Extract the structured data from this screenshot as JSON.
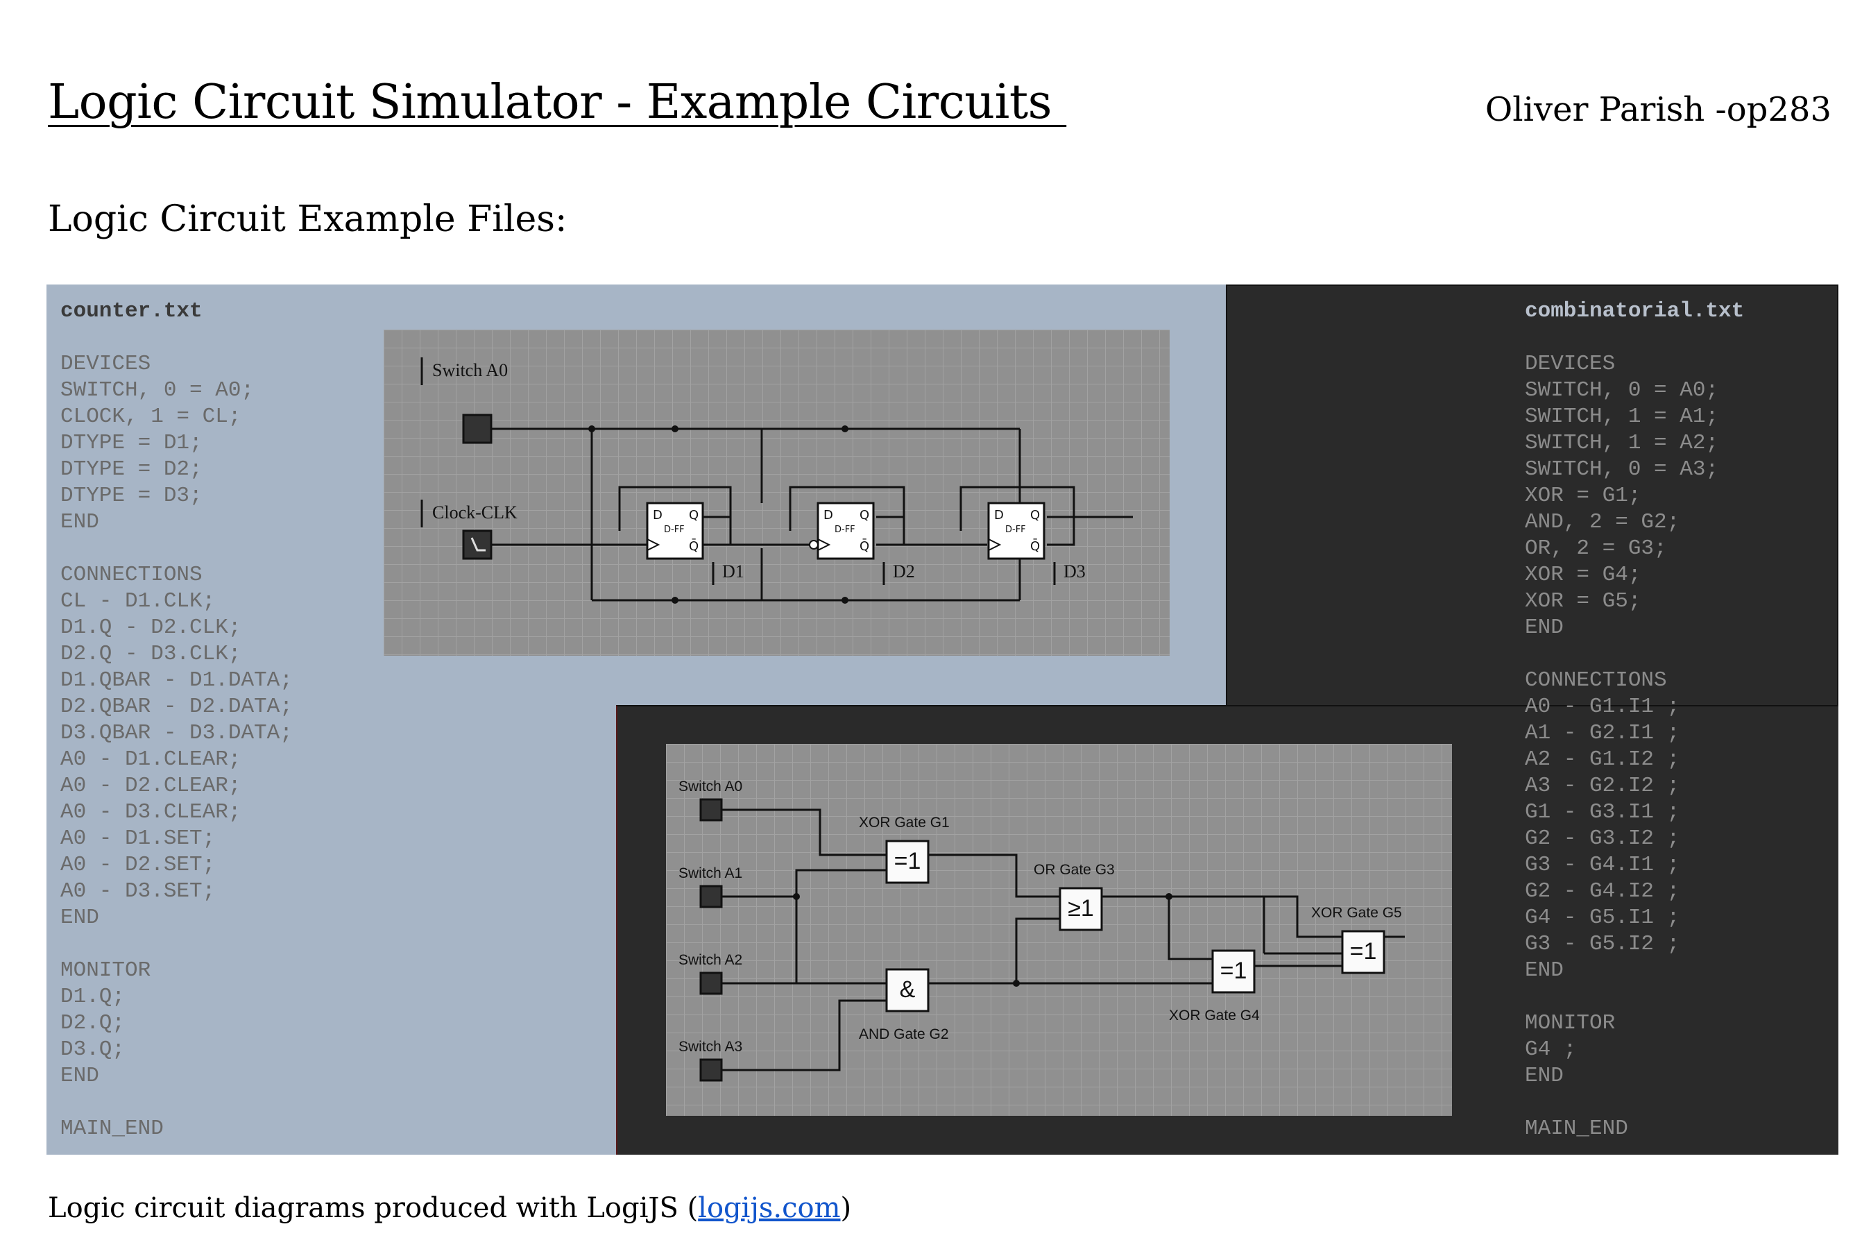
{
  "header": {
    "title": "Logic Circuit Simulator - Example Circuits ",
    "author": "Oliver Parish -op283"
  },
  "section_title": "Logic Circuit Example Files:",
  "counter_file": {
    "filename": "counter.txt",
    "lines": "DEVICES\nSWITCH, 0 = A0;\nCLOCK, 1 = CL;\nDTYPE = D1;\nDTYPE = D2;\nDTYPE = D3;\nEND\n\nCONNECTIONS\nCL - D1.CLK;\nD1.Q - D2.CLK;\nD2.Q - D3.CLK;\nD1.QBAR - D1.DATA;\nD2.QBAR - D2.DATA;\nD3.QBAR - D3.DATA;\nA0 - D1.CLEAR;\nA0 - D2.CLEAR;\nA0 - D3.CLEAR;\nA0 - D1.SET;\nA0 - D2.SET;\nA0 - D3.SET;\nEND\n\nMONITOR\nD1.Q;\nD2.Q;\nD3.Q;\nEND\n\nMAIN_END"
  },
  "combinatorial_file": {
    "filename": "combinatorial.txt",
    "lines": "DEVICES\nSWITCH, 0 = A0;\nSWITCH, 1 = A1;\nSWITCH, 1 = A2;\nSWITCH, 0 = A3;\nXOR = G1;\nAND, 2 = G2;\nOR, 2 = G3;\nXOR = G4;\nXOR = G5;\nEND\n\nCONNECTIONS\nA0 - G1.I1 ;\nA1 - G2.I1 ;\nA2 - G1.I2 ;\nA3 - G2.I2 ;\nG1 - G3.I1 ;\nG2 - G3.I2 ;\nG3 - G4.I1 ;\nG2 - G4.I2 ;\nG4 - G5.I1 ;\nG3 - G5.I2 ;\nEND\n\nMONITOR\nG4 ;\nEND\n\nMAIN_END"
  },
  "counter_diagram": {
    "switch_label": "Switch A0",
    "clock_label": "Clock-CLK",
    "ff_labels": [
      "D1",
      "D2",
      "D3"
    ],
    "ff_inner": "D-FF",
    "pin_d": "D",
    "pin_q": "Q",
    "pin_qbar": "Q̄"
  },
  "comb_diagram": {
    "switches": [
      "Switch A0",
      "Switch A1",
      "Switch A2",
      "Switch A3"
    ],
    "gates": [
      {
        "label": "XOR Gate G1",
        "symbol": "=1"
      },
      {
        "label": "AND Gate G2",
        "symbol": "&"
      },
      {
        "label": "OR Gate G3",
        "symbol": "≥1"
      },
      {
        "label": "XOR Gate G4",
        "symbol": "=1"
      },
      {
        "label": "XOR Gate G5",
        "symbol": "=1"
      }
    ]
  },
  "footer": {
    "text": "Logic circuit diagrams produced with LogiJS (",
    "link": "logijs.com",
    "close": ")"
  }
}
